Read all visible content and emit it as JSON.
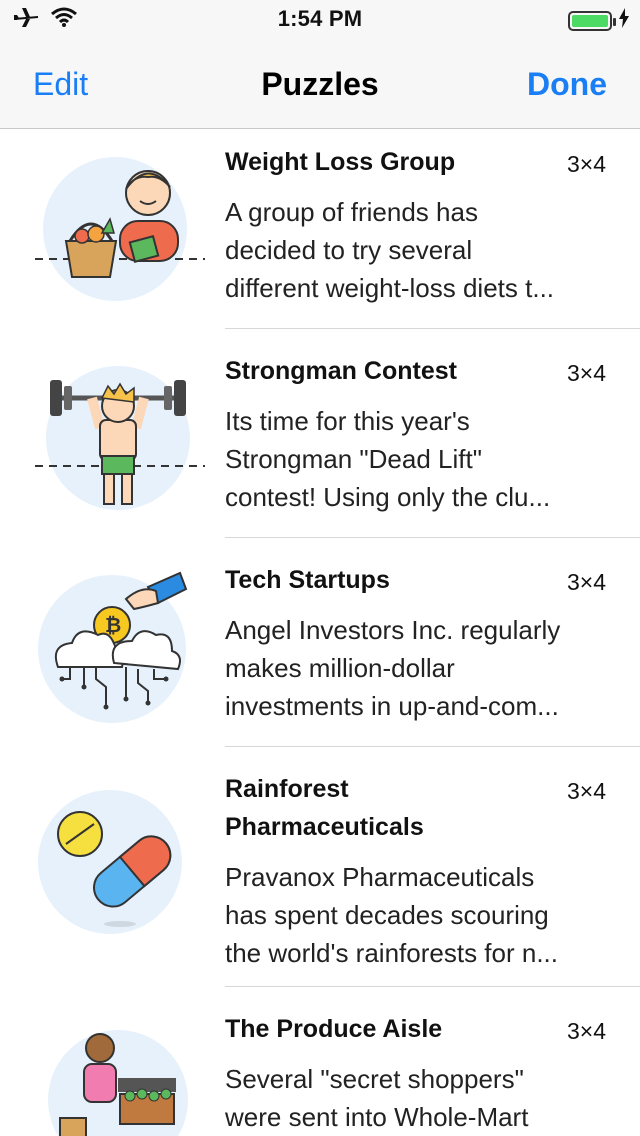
{
  "status_bar": {
    "time": "1:54 PM",
    "battery_color": "#4cd964"
  },
  "nav": {
    "edit_label": "Edit",
    "title": "Puzzles",
    "done_label": "Done",
    "accent": "#1a7ef5"
  },
  "puzzles": [
    {
      "title": "Weight Loss Group",
      "size": "3×4",
      "desc": [
        "A group of friends has",
        "decided to try several",
        "different weight-loss diets t..."
      ]
    },
    {
      "title": "Strongman Contest",
      "size": "3×4",
      "desc": [
        "Its time for this year's",
        "Strongman \"Dead Lift\"",
        "contest!  Using only the clu..."
      ]
    },
    {
      "title": "Tech Startups",
      "size": "3×4",
      "desc": [
        "Angel Investors Inc. regularly",
        "makes million-dollar",
        "investments in up-and-com..."
      ]
    },
    {
      "title": "Rainforest Pharmaceuticals",
      "size": "3×4",
      "desc": [
        "Pravanox Pharmaceuticals",
        "has spent decades scouring",
        "the world's rainforests for n..."
      ]
    },
    {
      "title": "The Produce Aisle",
      "size": "3×4",
      "desc": [
        "Several \"secret shoppers\"",
        "were sent into Whole-Mart",
        ""
      ]
    }
  ]
}
